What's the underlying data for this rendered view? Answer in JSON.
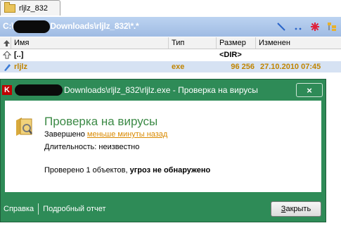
{
  "tab": {
    "label": "rljlz_832"
  },
  "pathbar": {
    "path_prefix": "C:\\",
    "path_suffix": "Downloads\\rljlz_832\\*.*"
  },
  "columns": {
    "name": "Имя",
    "type": "Тип",
    "size": "Размер",
    "modified": "Изменен"
  },
  "rows": {
    "up": {
      "name": "[..]",
      "size": "<DIR>"
    },
    "file": {
      "name": "rljlz",
      "type": "exe",
      "size": "96 256",
      "modified": "27.10.2010 07:45"
    }
  },
  "dialog": {
    "title_suffix": "Downloads\\rljlz_832\\rljlz.exe - Проверка на вирусы",
    "heading": "Проверка на вирусы",
    "completed_label": "Завершено",
    "completed_link": "меньше минуты назад",
    "duration": "Длительность: неизвестно",
    "checked_prefix": "Проверено 1 объектов, ",
    "checked_result": "угроз не обнаружено",
    "help_link": "Справка",
    "report_link": "Подробный отчет",
    "close_button": "Закрыть",
    "close_button_hotkey": "З",
    "close_button_rest": "акрыть"
  }
}
